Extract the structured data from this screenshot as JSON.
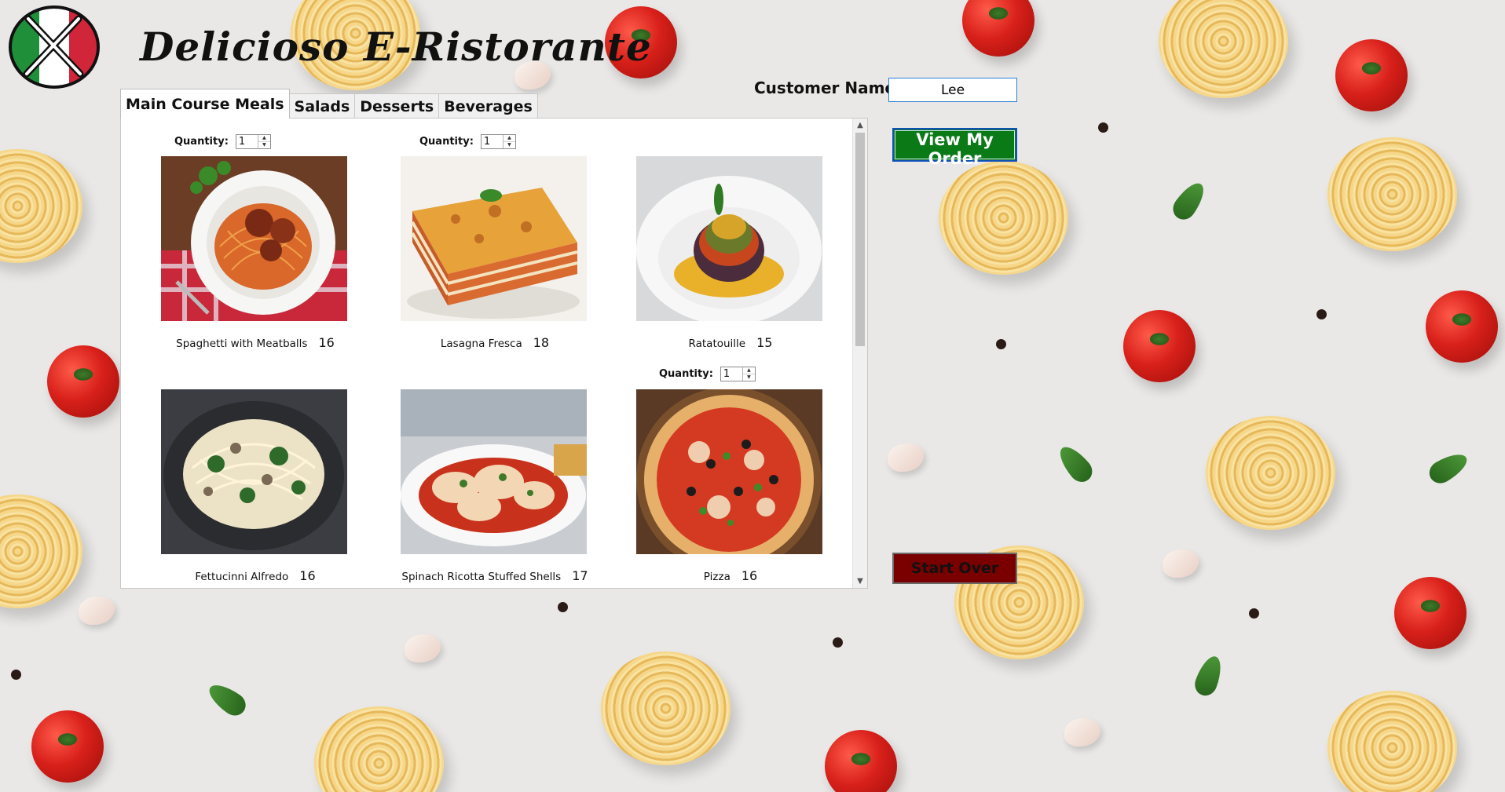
{
  "app": {
    "title": "Delicioso  E-Ristorante"
  },
  "customer": {
    "label": "Customer  Name:",
    "value": "Lee"
  },
  "buttons": {
    "view_order": "View  My  Order",
    "start_over": "Start  Over"
  },
  "tabs": [
    {
      "label": "Main  Course  Meals",
      "active": true
    },
    {
      "label": "Salads",
      "active": false
    },
    {
      "label": "Desserts",
      "active": false
    },
    {
      "label": "Beverages",
      "active": false
    }
  ],
  "quantity_label": "Quantity:",
  "items": [
    {
      "name": "Spaghetti with Meatballs",
      "price": "16",
      "quantity": "1",
      "show_quantity": true
    },
    {
      "name": "Lasagna Fresca",
      "price": "18",
      "quantity": "1",
      "show_quantity": true
    },
    {
      "name": "Ratatouille",
      "price": "15",
      "quantity": "",
      "show_quantity": false
    },
    {
      "name": "Fettucinni Alfredo",
      "price": "16",
      "quantity": "",
      "show_quantity": false
    },
    {
      "name": "Spinach Ricotta Stuffed Shells",
      "price": "17",
      "quantity": "",
      "show_quantity": false
    },
    {
      "name": "Pizza",
      "price": "16",
      "quantity": "1",
      "show_quantity": true
    }
  ],
  "colors": {
    "view_button": "#0a7a17",
    "start_button": "#7a0000",
    "accent_border": "#0e52b7"
  }
}
